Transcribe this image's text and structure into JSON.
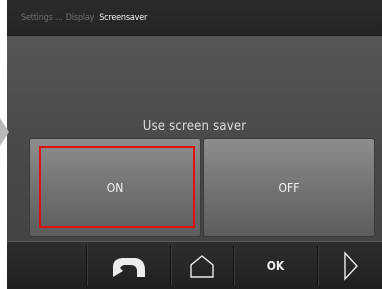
{
  "breadcrumb": {
    "dim_1": "Settings",
    "separator": "...",
    "dim_2": "Display",
    "active": "Screensaver"
  },
  "setting": {
    "label": "Use screen saver",
    "options": [
      "ON",
      "OFF"
    ],
    "focused": "ON"
  },
  "bottombar": {
    "back_icon": "back-arrow-icon",
    "home_icon": "home-icon",
    "ok_label": "OK",
    "next_icon": "next-arrow-icon"
  },
  "colors": {
    "focus_border": "#e01010",
    "background": "#4a4a4a"
  }
}
